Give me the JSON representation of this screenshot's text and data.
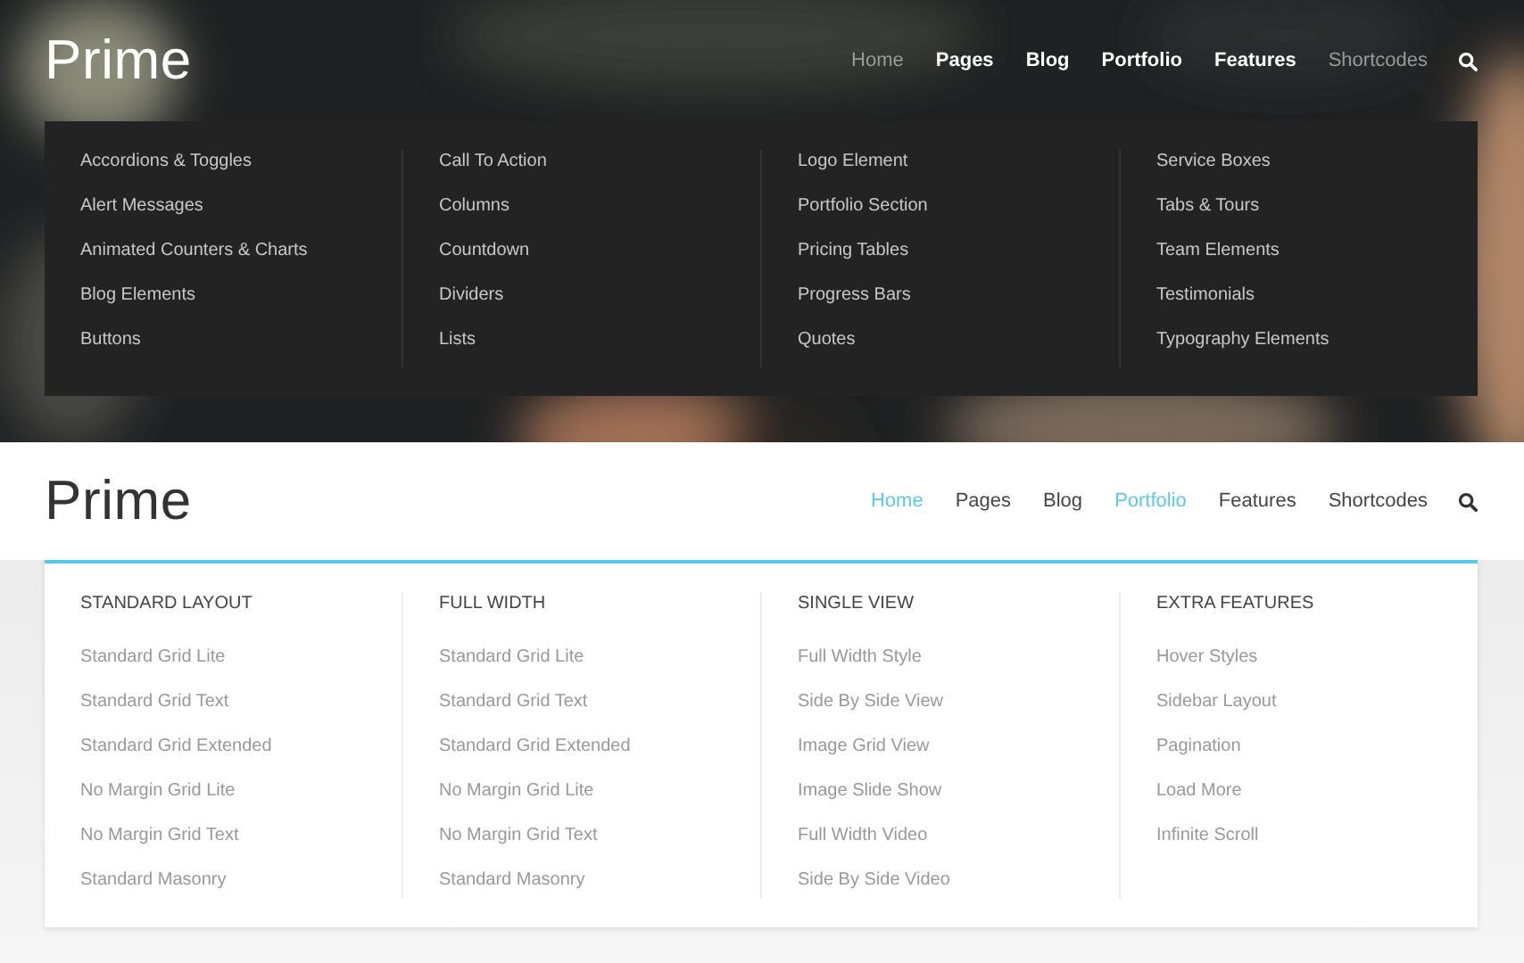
{
  "dark_demo": {
    "logo": "Prime",
    "nav": [
      {
        "label": "Home",
        "selected": true
      },
      {
        "label": "Pages",
        "selected": false
      },
      {
        "label": "Blog",
        "selected": false
      },
      {
        "label": "Portfolio",
        "selected": false
      },
      {
        "label": "Features",
        "selected": false
      },
      {
        "label": "Shortcodes",
        "selected": true
      }
    ],
    "mega_menu": {
      "columns": [
        {
          "items": [
            "Accordions & Toggles",
            "Alert Messages",
            "Animated Counters & Charts",
            "Blog Elements",
            "Buttons"
          ]
        },
        {
          "items": [
            "Call To Action",
            "Columns",
            "Countdown",
            "Dividers",
            "Lists"
          ]
        },
        {
          "items": [
            "Logo Element",
            "Portfolio Section",
            "Pricing Tables",
            "Progress Bars",
            "Quotes"
          ]
        },
        {
          "items": [
            "Service Boxes",
            "Tabs & Tours",
            "Team Elements",
            "Testimonials",
            "Typography Elements"
          ]
        }
      ]
    }
  },
  "light_demo": {
    "logo": "Prime",
    "nav": [
      {
        "label": "Home",
        "selected": true
      },
      {
        "label": "Pages",
        "selected": false
      },
      {
        "label": "Blog",
        "selected": false
      },
      {
        "label": "Portfolio",
        "selected": true
      },
      {
        "label": "Features",
        "selected": false
      },
      {
        "label": "Shortcodes",
        "selected": false
      }
    ],
    "mega_menu": {
      "columns": [
        {
          "heading": "STANDARD LAYOUT",
          "items": [
            "Standard Grid Lite",
            "Standard Grid Text",
            "Standard Grid Extended",
            "No Margin Grid Lite",
            "No Margin Grid Text",
            "Standard Masonry"
          ]
        },
        {
          "heading": "FULL WIDTH",
          "items": [
            "Standard Grid Lite",
            "Standard Grid Text",
            "Standard Grid Extended",
            "No Margin Grid Lite",
            "No Margin Grid Text",
            "Standard Masonry"
          ]
        },
        {
          "heading": "SINGLE VIEW",
          "items": [
            "Full Width Style",
            "Side By Side View",
            "Image Grid View",
            "Image Slide Show",
            "Full Width Video",
            "Side By Side Video"
          ]
        },
        {
          "heading": "EXTRA FEATURES",
          "items": [
            "Hover Styles",
            "Sidebar Layout",
            "Pagination",
            "Load More",
            "Infinite Scroll"
          ]
        }
      ]
    }
  }
}
